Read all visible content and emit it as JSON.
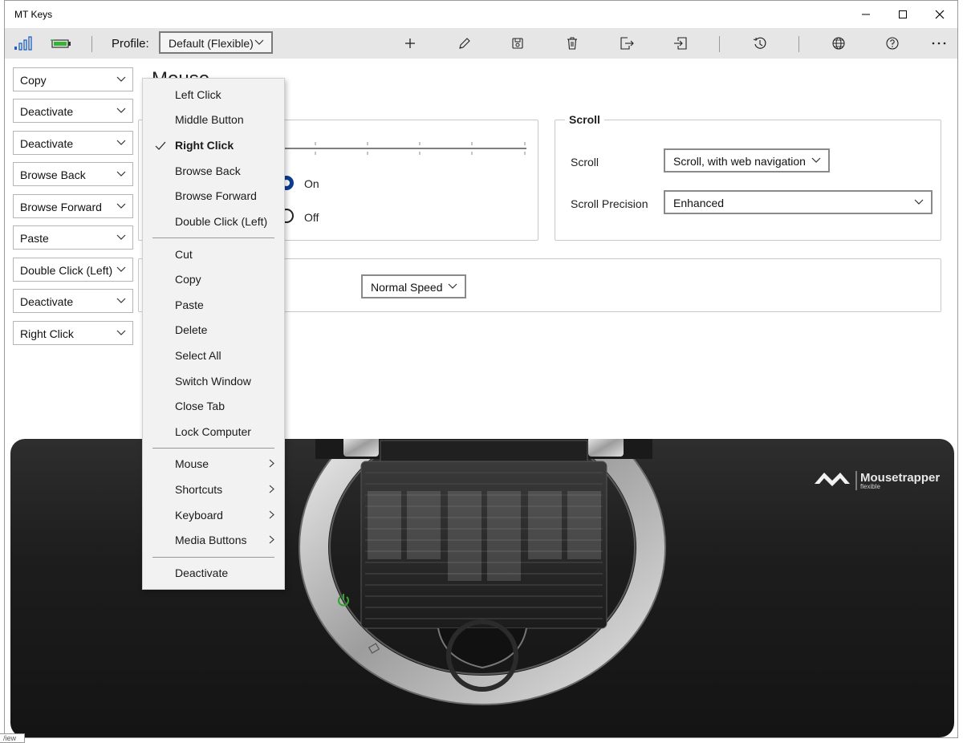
{
  "app": {
    "title": "MT Keys"
  },
  "window_controls": {
    "minimize": "—",
    "maximize": "☐",
    "close": "✕"
  },
  "toolbar": {
    "profile_label": "Profile:",
    "profile_value": "Default (Flexible)",
    "icons": [
      "signal-icon",
      "battery-icon",
      "add-icon",
      "edit-icon",
      "save-icon",
      "delete-icon",
      "export-icon",
      "import-icon",
      "history-icon",
      "globe-icon",
      "help-icon",
      "more-icon"
    ]
  },
  "buttons": [
    "Copy",
    "Deactivate",
    "Deactivate",
    "Browse Back",
    "Browse Forward",
    "Paste",
    "Double Click (Left)",
    "Deactivate",
    "Right Click"
  ],
  "main": {
    "heading": "Mouse",
    "radio_on": "On",
    "radio_off": "Off",
    "speed_value": "Normal Speed",
    "scroll_group": {
      "title": "Scroll",
      "scroll_label": "Scroll",
      "scroll_value": "Scroll, with web navigation",
      "precision_label": "Scroll Precision",
      "precision_value": "Enhanced"
    }
  },
  "menu": {
    "group1": [
      "Left Click",
      "Middle Button",
      "Right Click",
      "Browse Back",
      "Browse Forward",
      "Double Click (Left)"
    ],
    "checked": "Right Click",
    "group2": [
      "Cut",
      "Copy",
      "Paste",
      "Delete",
      "Select All",
      "Switch Window",
      "Close Tab",
      "Lock Computer"
    ],
    "group3": [
      "Mouse",
      "Shortcuts",
      "Keyboard",
      "Media Buttons"
    ],
    "group4": [
      "Deactivate"
    ]
  },
  "device": {
    "brand": "Mousetrapper",
    "brand_sub": "flexible"
  },
  "colors": {
    "accent": "#0b3d91",
    "toolbar_bg": "#e6e6e6",
    "menu_bg": "#f2f2f2",
    "power_green": "#2fa52f",
    "battery_green": "#35b335",
    "signal_blue": "#1f5fbf"
  },
  "status_fragment": "/iew"
}
